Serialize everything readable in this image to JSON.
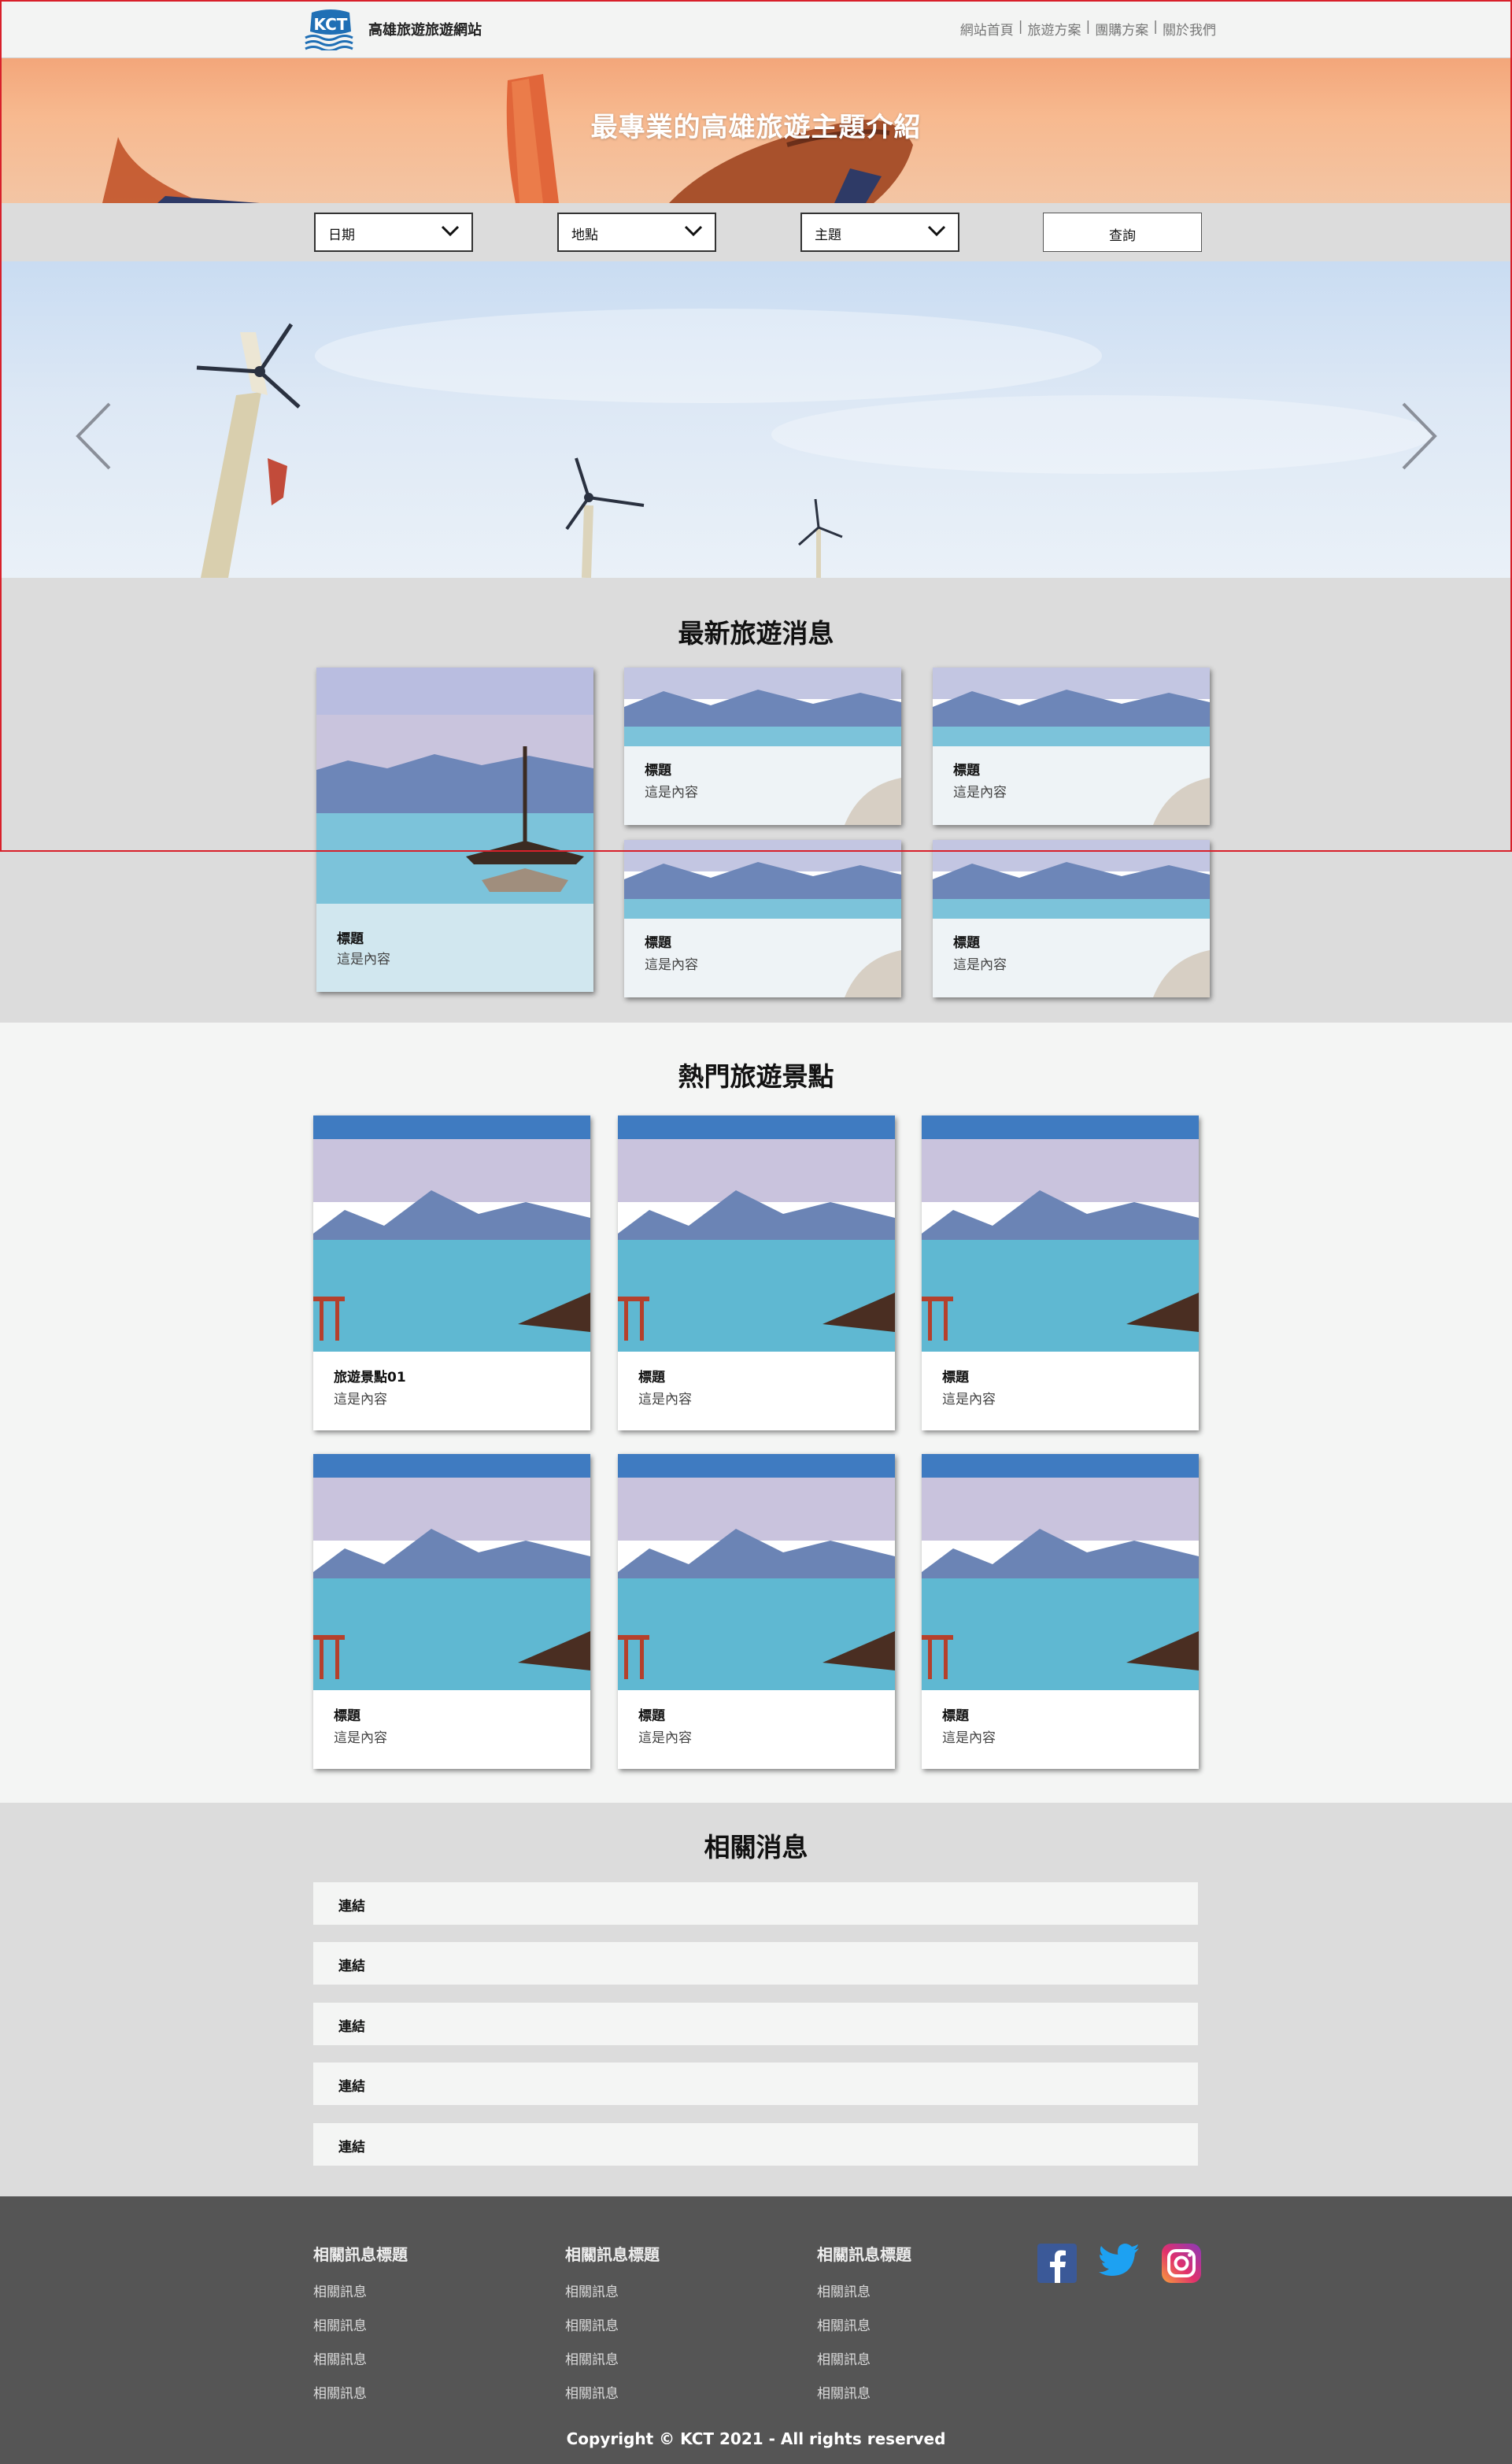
{
  "header": {
    "logo_badge": "KCT",
    "site_name": "高雄旅遊旅遊網站",
    "nav": [
      "網站首頁",
      "旅遊方案",
      "團購方案",
      "關於我們"
    ],
    "separator": "|"
  },
  "hero": {
    "title": "最專業的高雄旅遊主題介紹"
  },
  "search": {
    "date_label": "日期",
    "place_label": "地點",
    "theme_label": "主題",
    "query_label": "查詢"
  },
  "news": {
    "title": "最新旅遊消息",
    "cards": [
      {
        "title": "標題",
        "text": "這是內容"
      },
      {
        "title": "標題",
        "text": "這是內容"
      },
      {
        "title": "標題",
        "text": "這是內容"
      },
      {
        "title": "標題",
        "text": "這是內容"
      },
      {
        "title": "標題",
        "text": "這是內容"
      }
    ]
  },
  "spots": {
    "title": "熱門旅遊景點",
    "cards": [
      {
        "title": "旅遊景點01",
        "text": "這是內容"
      },
      {
        "title": "標題",
        "text": "這是內容"
      },
      {
        "title": "標題",
        "text": "這是內容"
      },
      {
        "title": "標題",
        "text": "這是內容"
      },
      {
        "title": "標題",
        "text": "這是內容"
      },
      {
        "title": "標題",
        "text": "這是內容"
      }
    ]
  },
  "related": {
    "title": "相關消息",
    "links": [
      "連結",
      "連結",
      "連結",
      "連結",
      "連結"
    ]
  },
  "footer": {
    "columns": [
      {
        "heading": "相關訊息標題",
        "items": [
          "相關訊息",
          "相關訊息",
          "相關訊息",
          "相關訊息"
        ]
      },
      {
        "heading": "相關訊息標題",
        "items": [
          "相關訊息",
          "相關訊息",
          "相關訊息",
          "相關訊息"
        ]
      },
      {
        "heading": "相關訊息標題",
        "items": [
          "相關訊息",
          "相關訊息",
          "相關訊息",
          "相關訊息"
        ]
      }
    ],
    "social": [
      "facebook-icon",
      "twitter-icon",
      "instagram-icon"
    ],
    "copyright": "Copyright © KCT 2021 - All rights reserved"
  },
  "colors": {
    "accent_red": "#d8202a",
    "footer_bg": "#555555",
    "section_gray": "#dcdcdc",
    "section_light": "#f4f5f4",
    "logo_blue": "#1f6fb5"
  }
}
